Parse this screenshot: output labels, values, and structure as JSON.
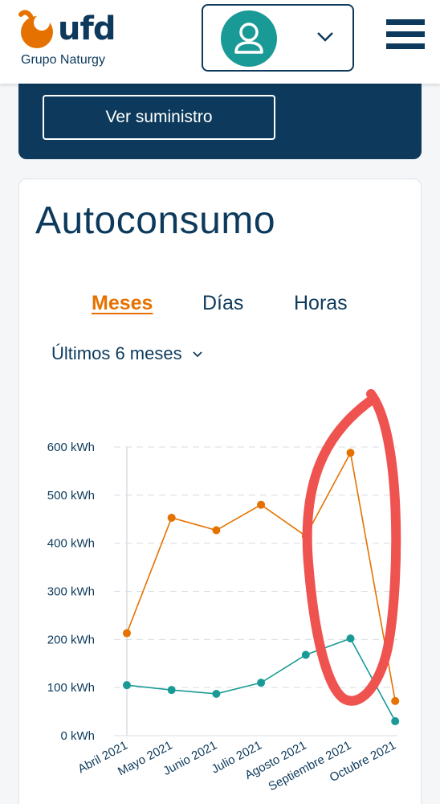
{
  "header": {
    "logo_text": "ufd",
    "logo_subtitle": "Grupo Naturgy",
    "user_icon": "user-icon",
    "dropdown_icon": "chevron-down-icon",
    "menu_icon": "hamburger-menu-icon"
  },
  "supply_card": {
    "button_label": "Ver suministro"
  },
  "section": {
    "title": "Autoconsumo",
    "tabs": [
      {
        "label": "Meses",
        "active": true
      },
      {
        "label": "Días",
        "active": false
      },
      {
        "label": "Horas",
        "active": false
      }
    ],
    "range_selector": "Últimos 6 meses"
  },
  "colors": {
    "brand_dark": "#0d3a5c",
    "brand_orange": "#e57200",
    "series_orange": "#e57200",
    "series_teal": "#1a9a96",
    "annotation_red": "#ef5350"
  },
  "chart_data": {
    "type": "line",
    "categories": [
      "Abril 2021",
      "Mayo 2021",
      "Junio 2021",
      "Julio 2021",
      "Agosto 2021",
      "Septiembre 2021",
      "Octubre 2021"
    ],
    "y_ticks": [
      "0 kWh",
      "100 kWh",
      "200 kWh",
      "300 kWh",
      "400 kWh",
      "500 kWh",
      "600 kWh"
    ],
    "ylim": [
      0,
      600
    ],
    "grid": true,
    "series": [
      {
        "color": "#e57200",
        "values": [
          213,
          453,
          427,
          480,
          415,
          588,
          72
        ]
      },
      {
        "color": "#1a9a96",
        "values": [
          105,
          95,
          87,
          110,
          168,
          202,
          30
        ]
      }
    ]
  }
}
